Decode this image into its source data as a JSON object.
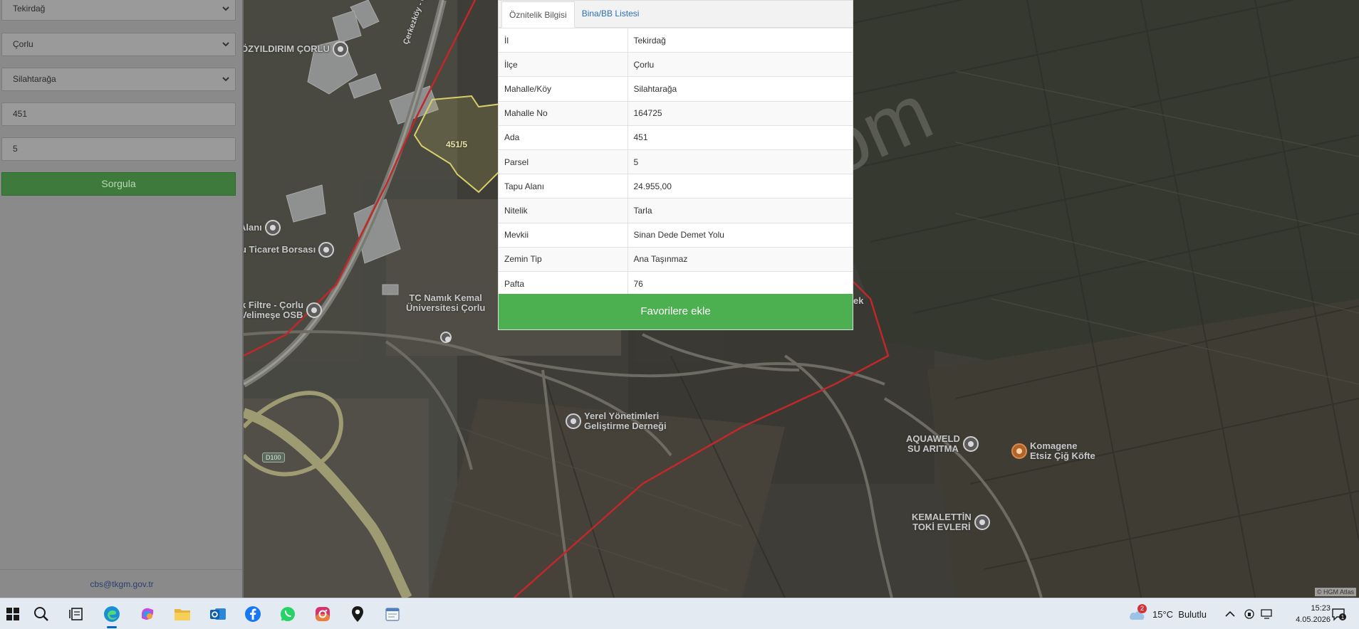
{
  "query_form": {
    "province": "Tekirdağ",
    "district": "Çorlu",
    "neighborhood": "Silahtarağa",
    "block_no": "451",
    "parcel_no": "5",
    "query_button": "Sorgula",
    "footer_email": "cbs@tkgm.gov.tr"
  },
  "attribute_panel": {
    "tabs": [
      {
        "label": "Öznitelik Bilgisi",
        "active": true
      },
      {
        "label": "Bina/BB Listesi",
        "active": false
      }
    ],
    "rows": [
      {
        "key": "İl",
        "value": "Tekirdağ"
      },
      {
        "key": "İlçe",
        "value": "Çorlu"
      },
      {
        "key": "Mahalle/Köy",
        "value": "Silahtarağa"
      },
      {
        "key": "Mahalle No",
        "value": "164725"
      },
      {
        "key": "Ada",
        "value": "451"
      },
      {
        "key": "Parsel",
        "value": "5"
      },
      {
        "key": "Tapu Alanı",
        "value": "24.955,00"
      },
      {
        "key": "Nitelik",
        "value": "Tarla"
      },
      {
        "key": "Mevkii",
        "value": "Sinan Dede Demet Yolu"
      },
      {
        "key": "Zemin Tip",
        "value": "Ana Taşınmaz"
      },
      {
        "key": "Pafta",
        "value": "76"
      }
    ],
    "favorite_button": "Favorilere ekle"
  },
  "map": {
    "parcel_label": "451/5",
    "road_label": "Çerkezköy - Çorlu Yolu",
    "road_shield": "D100",
    "watermark": "emlakjet.com",
    "attribution": "© HGM Atlas",
    "pois": [
      {
        "label": "ÖZYILDIRIM ÇORLU",
        "icon": "location-pin-icon",
        "pin": "gray"
      },
      {
        "label": "Alanı",
        "icon": "museum-icon",
        "pin": "gray"
      },
      {
        "label": "u Ticaret Borsası",
        "icon": "location-pin-icon",
        "pin": "gray"
      },
      {
        "label": "k Filtre - Çorlu\nVelimeşe OSB",
        "icon": "lock-icon",
        "pin": "gray"
      },
      {
        "label": "TC Namık Kemal\nÜniversitesi Çorlu",
        "icon": "school-icon",
        "pin": "gray"
      },
      {
        "label": "Yerel Yönetimleri\nGeliştirme Derneği",
        "icon": "location-pin-icon",
        "pin": "gray"
      },
      {
        "label": "AQUAWELD\nSU ARITMA",
        "icon": "location-pin-icon",
        "pin": "gray"
      },
      {
        "label": "Komagene\nEtsiz Çiğ Köfte",
        "icon": "restaurant-icon",
        "pin": "orange"
      },
      {
        "label": "KEMALETTİN\nTOKİ EVLERİ",
        "icon": "location-pin-icon",
        "pin": "gray"
      },
      {
        "label": "ek",
        "icon": "",
        "pin": "none"
      }
    ]
  },
  "taskbar": {
    "apps": [
      "start-icon",
      "search-icon",
      "task-view-icon",
      "edge-icon",
      "copilot-icon",
      "file-explorer-icon",
      "outlook-icon",
      "facebook-icon",
      "whatsapp-icon",
      "instagram-icon",
      "maps-icon",
      "notepad-icon"
    ],
    "weather_badge": "2",
    "weather": "15°C  Bulutlu",
    "time": "15:23",
    "date": "4.05.2026"
  },
  "colors": {
    "accent_green": "#4caf50",
    "query_green": "#3d7a3c",
    "boundary_red": "#c0282a",
    "parcel_yellow": "#d8cf6a",
    "link_blue": "#2a6fb5"
  }
}
